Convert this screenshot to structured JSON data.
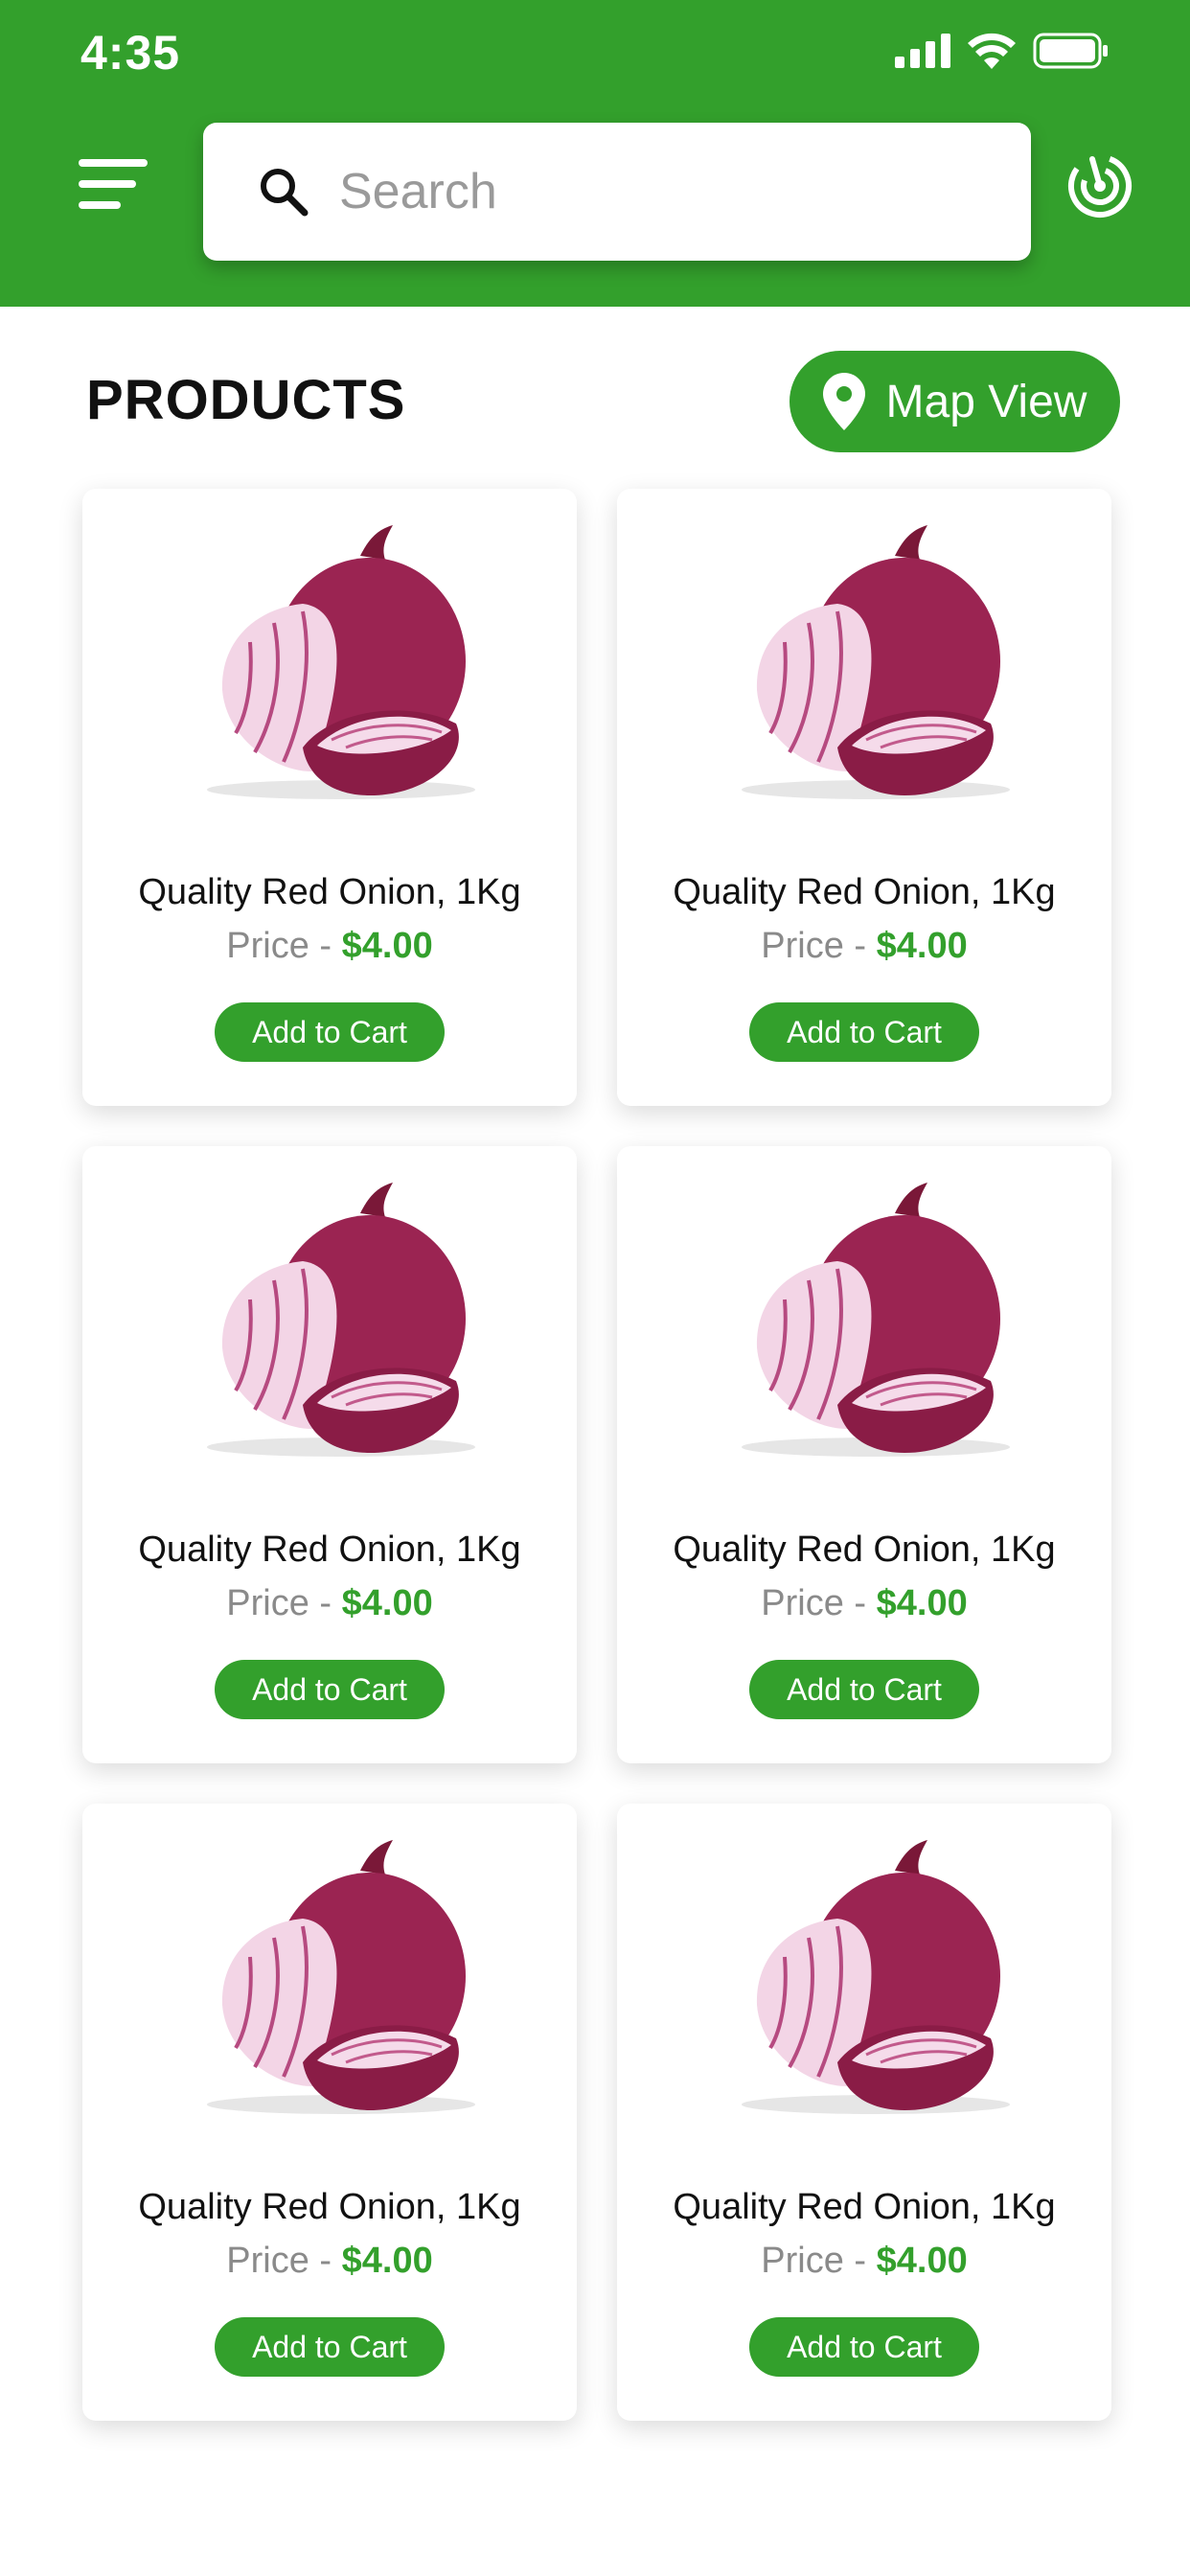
{
  "status_bar": {
    "time": "4:35"
  },
  "search": {
    "placeholder": "Search"
  },
  "section": {
    "title": "PRODUCTS",
    "map_view_label": "Map View"
  },
  "colors": {
    "brand_green": "#33a02c",
    "background": "#ffffff"
  },
  "icons": {
    "menu": "menu-lines-icon",
    "search": "search-icon",
    "locate": "radar-locate-icon",
    "map_pin": "map-pin-icon"
  },
  "products": [
    {
      "name": "Quality Red Onion, 1Kg",
      "price_label": "Price - ",
      "price": "$4.00",
      "cta": "Add to Cart"
    },
    {
      "name": "Quality Red Onion, 1Kg",
      "price_label": "Price - ",
      "price": "$4.00",
      "cta": "Add to Cart"
    },
    {
      "name": "Quality Red Onion, 1Kg",
      "price_label": "Price - ",
      "price": "$4.00",
      "cta": "Add to Cart"
    },
    {
      "name": "Quality Red Onion, 1Kg",
      "price_label": "Price - ",
      "price": "$4.00",
      "cta": "Add to Cart"
    },
    {
      "name": "Quality Red Onion, 1Kg",
      "price_label": "Price - ",
      "price": "$4.00",
      "cta": "Add to Cart"
    },
    {
      "name": "Quality Red Onion, 1Kg",
      "price_label": "Price - ",
      "price": "$4.00",
      "cta": "Add to Cart"
    }
  ]
}
